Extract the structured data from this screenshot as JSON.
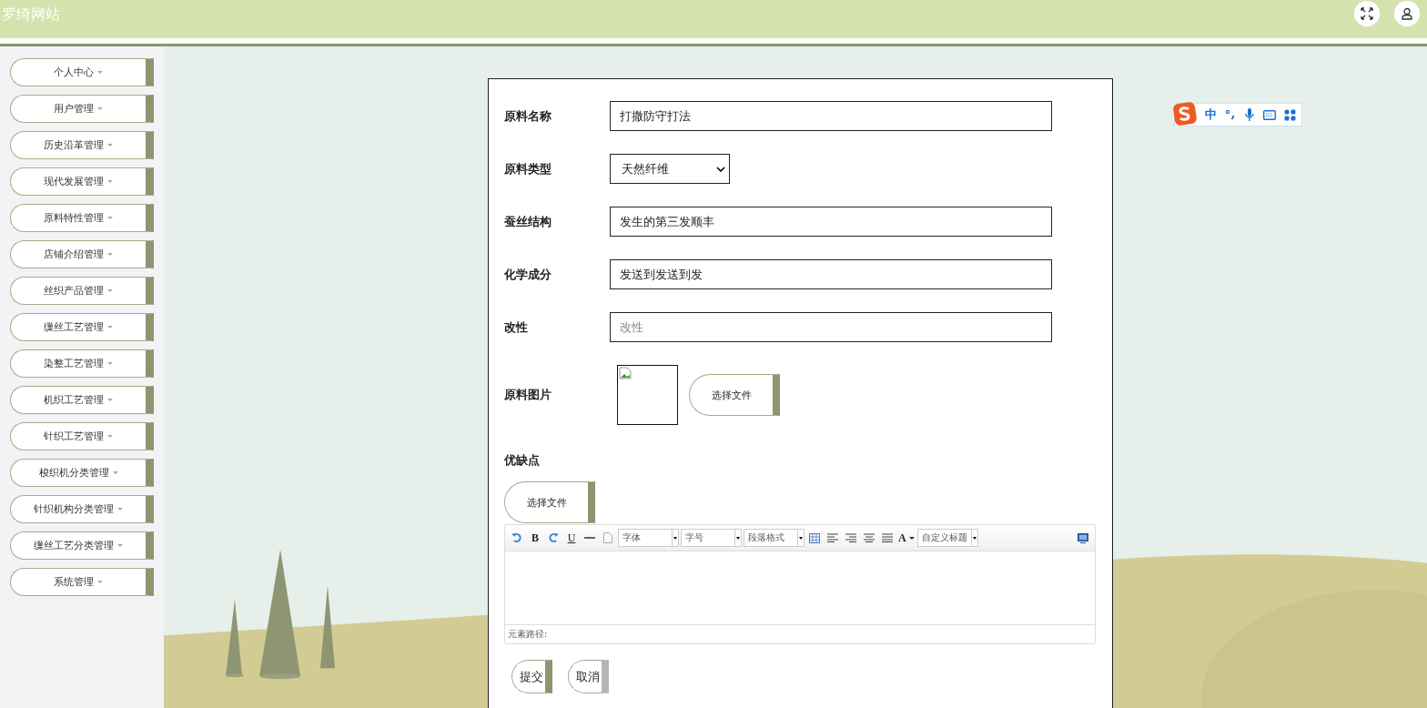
{
  "header": {
    "title": "罗绮网站"
  },
  "sidebar": {
    "items": [
      {
        "label": "个人中心"
      },
      {
        "label": "用户管理"
      },
      {
        "label": "历史沿革管理"
      },
      {
        "label": "现代发展管理"
      },
      {
        "label": "原料特性管理"
      },
      {
        "label": "店铺介绍管理"
      },
      {
        "label": "丝织产品管理"
      },
      {
        "label": "缫丝工艺管理"
      },
      {
        "label": "染整工艺管理"
      },
      {
        "label": "机织工艺管理"
      },
      {
        "label": "针织工艺管理"
      },
      {
        "label": "梭织机分类管理"
      },
      {
        "label": "针织机构分类管理"
      },
      {
        "label": "缫丝工艺分类管理"
      },
      {
        "label": "系统管理"
      }
    ]
  },
  "form": {
    "fields": [
      {
        "kind": "text",
        "label": "原料名称",
        "value": "打撒防守打法"
      },
      {
        "kind": "select",
        "label": "原料类型",
        "value": "天然纤维"
      },
      {
        "kind": "text",
        "label": "蚕丝结构",
        "value": "发生的第三发顺丰"
      },
      {
        "kind": "text",
        "label": "化学成分",
        "value": "发送到发送到发"
      },
      {
        "kind": "text",
        "label": "改性",
        "placeholder": "改性"
      },
      {
        "kind": "image",
        "label": "原料图片",
        "button": "选择文件"
      }
    ],
    "editor": {
      "label": "优缺点",
      "button": "选择文件",
      "toolbar": [
        {
          "kind": "undo"
        },
        {
          "kind": "bold",
          "text": "B"
        },
        {
          "kind": "redo"
        },
        {
          "kind": "underline",
          "text": "U"
        },
        {
          "kind": "hr"
        },
        {
          "kind": "doc"
        },
        {
          "kind": "dropdown",
          "text": "字体"
        },
        {
          "kind": "dropdown",
          "text": "字号"
        },
        {
          "kind": "dropdown",
          "text": "段落格式"
        },
        {
          "kind": "table"
        },
        {
          "kind": "align-left"
        },
        {
          "kind": "align-right"
        },
        {
          "kind": "align-center"
        },
        {
          "kind": "justify"
        },
        {
          "kind": "fontcolor",
          "text": "A"
        },
        {
          "kind": "dropdown",
          "text": "自定义标题"
        }
      ],
      "status": "元素路径:"
    },
    "buttons": [
      {
        "label": "提交",
        "kind": "primary"
      },
      {
        "label": "取消",
        "kind": "secondary"
      }
    ]
  },
  "ime": {
    "mode": "中"
  }
}
